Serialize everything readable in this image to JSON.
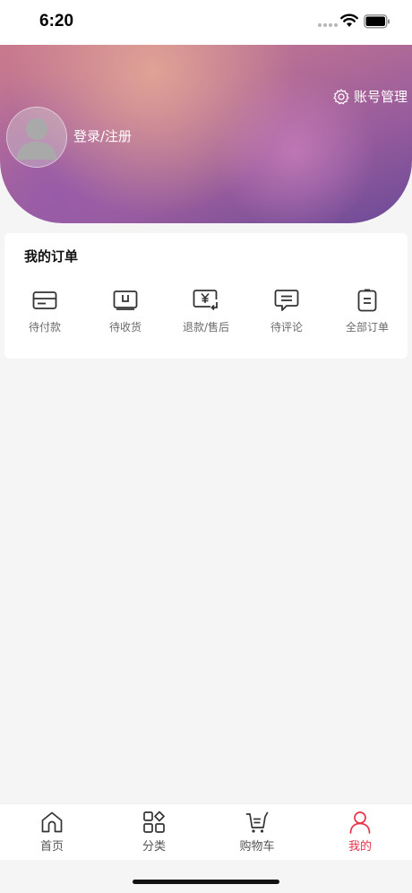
{
  "status_bar": {
    "time": "6:20"
  },
  "profile": {
    "login_label": "登录/注册",
    "account_manage_label": "账号管理"
  },
  "orders": {
    "title": "我的订单",
    "items": [
      {
        "label": "待付款",
        "icon": "card-icon"
      },
      {
        "label": "待收货",
        "icon": "delivery-box-icon"
      },
      {
        "label": "退款/售后",
        "icon": "refund-icon"
      },
      {
        "label": "待评论",
        "icon": "comment-icon"
      },
      {
        "label": "全部订单",
        "icon": "clipboard-icon"
      }
    ]
  },
  "tabbar": {
    "items": [
      {
        "label": "首页",
        "icon": "home-icon"
      },
      {
        "label": "分类",
        "icon": "category-icon"
      },
      {
        "label": "购物车",
        "icon": "cart-icon"
      },
      {
        "label": "我的",
        "icon": "user-icon"
      }
    ],
    "active_index": 3,
    "active_color": "#e8334a"
  }
}
